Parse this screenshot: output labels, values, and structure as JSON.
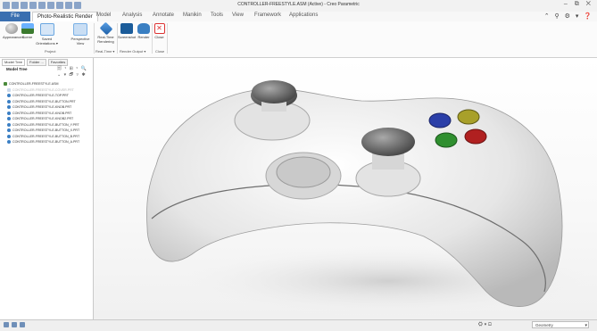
{
  "window": {
    "title": "CONTROLLER-FREESTYLE.ASM (Active) - Creo Parametric",
    "controls": "– ⧉ ✕"
  },
  "menu": {
    "file": "File",
    "tabs": [
      "Photo-Realistic Render",
      "Model",
      "Analysis",
      "Annotate",
      "Manikin",
      "Tools",
      "View",
      "Framework",
      "Applications"
    ],
    "right_icons": "⌃ ⚲ ⚙ ▾ ❓"
  },
  "ribbon": {
    "buttons": [
      {
        "label": "Appearances",
        "sub": "▾",
        "color": "#9a9a9a"
      },
      {
        "label": "Scene",
        "sub": "▾",
        "color": "#4c8fd1"
      },
      {
        "label": "Saved Orientations ▾",
        "sub": "",
        "color": "#6aa6e0"
      },
      {
        "label": "Perspective View",
        "sub": "",
        "color": "#7ab0e6"
      },
      {
        "label": "Real-Time Rendering",
        "sub": "",
        "color": "#2d77c1"
      },
      {
        "label": "Screenshot",
        "sub": "",
        "color": "#1b5c9a"
      },
      {
        "label": "Render",
        "sub": "",
        "color": "#3a7fc2"
      },
      {
        "label": "Close",
        "sub": "",
        "color": "#d33"
      }
    ],
    "groups": [
      "Project",
      "Real-Time ▾",
      "Render Output ▾",
      "Close"
    ]
  },
  "panel": {
    "tabs": [
      "Model Tree",
      "Folder ...",
      "Favorites"
    ],
    "header": "Model Tree",
    "tools": "🗐 ▾ ⊞ ▾ 🔍",
    "tools2": "⌄ ▾ 🗗 ▿ ✱",
    "tree": [
      {
        "label": "CONTROLLER-FREESTYLE.ASM",
        "kind": "root"
      },
      {
        "label": "CONTROLLER-FREESTYLE-COVER.PRT",
        "kind": "grey"
      },
      {
        "label": "CONTROLLER-FREESTYLE-TOP.PRT",
        "kind": "part"
      },
      {
        "label": "CONTROLLER-FREESTYLE-BUTTON.PRT",
        "kind": "part"
      },
      {
        "label": "CONTROLLER-FREESTYLE-KNOB.PRT",
        "kind": "part"
      },
      {
        "label": "CONTROLLER-FREESTYLE-KNOB.PRT",
        "kind": "part"
      },
      {
        "label": "CONTROLLER-FREESTYLE-KNOB2.PRT",
        "kind": "part"
      },
      {
        "label": "CONTROLLER-FREESTYLE-BUTTON_Y.PRT",
        "kind": "part"
      },
      {
        "label": "CONTROLLER-FREESTYLE-BUTTON_X.PRT",
        "kind": "part"
      },
      {
        "label": "CONTROLLER-FREESTYLE-BUTTON_B.PRT",
        "kind": "part"
      },
      {
        "label": "CONTROLLER-FREESTYLE-BUTTON_A.PRT",
        "kind": "part"
      }
    ]
  },
  "status": {
    "tools": "⛭ ▾ ⊡",
    "filter": "Geometry",
    "filter_dropdown": "▾"
  },
  "colors": {
    "file_tab": "#3a6fb0",
    "button_blue": "#2b3fa8",
    "button_yellow": "#a8a02a",
    "button_green": "#2f8f2f",
    "button_red": "#b02020",
    "controller_body": "#efefef"
  }
}
